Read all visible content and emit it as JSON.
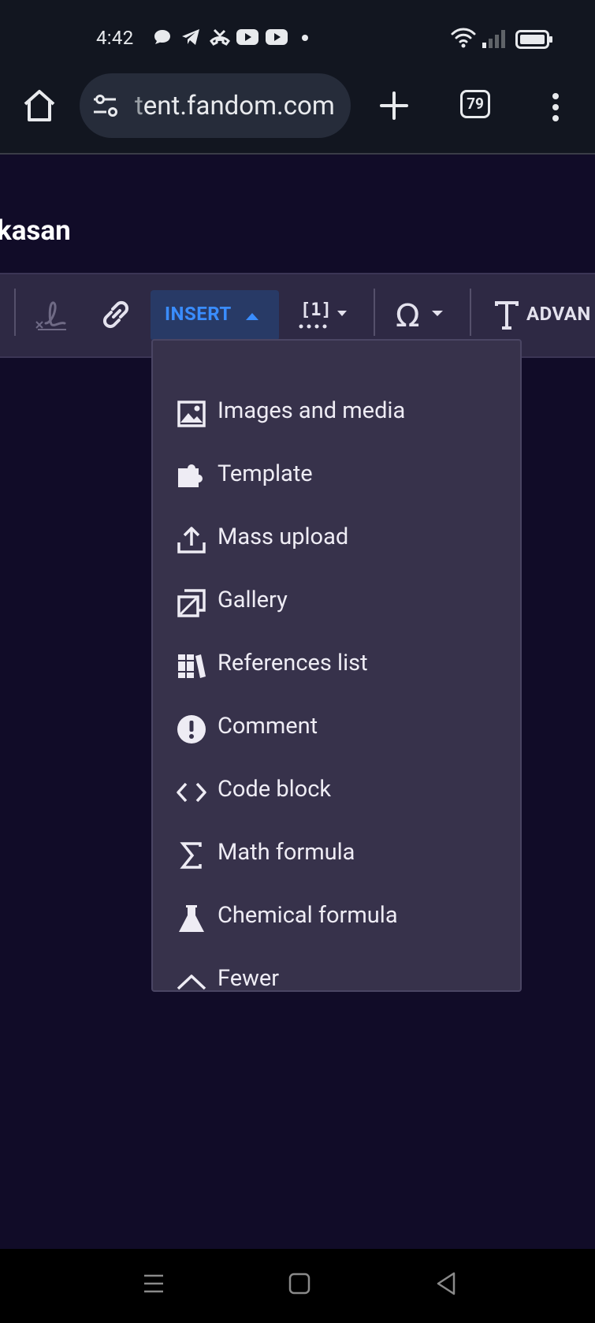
{
  "status_bar": {
    "time": "4:42"
  },
  "browser": {
    "url_faded": "t",
    "url": "ent.fandom.com",
    "tab_count": "79"
  },
  "page": {
    "title": "kasan"
  },
  "toolbar": {
    "insert_label": "INSERT",
    "advanced_label": "ADVAN"
  },
  "insert_menu": {
    "items": [
      {
        "label": "Images and media",
        "icon": "image-icon"
      },
      {
        "label": "Template",
        "icon": "puzzle-icon"
      },
      {
        "label": "Mass upload",
        "icon": "upload-icon"
      },
      {
        "label": "Gallery",
        "icon": "gallery-icon"
      },
      {
        "label": "References list",
        "icon": "books-icon"
      },
      {
        "label": "Comment",
        "icon": "exclamation-icon"
      },
      {
        "label": "Code block",
        "icon": "code-icon"
      },
      {
        "label": "Math formula",
        "icon": "sigma-icon"
      },
      {
        "label": "Chemical formula",
        "icon": "flask-icon"
      },
      {
        "label": "Fewer",
        "icon": "chevron-up-icon"
      }
    ]
  },
  "colors": {
    "page_bg": "#110c28",
    "toolbar_bg": "#2e2944",
    "menu_bg": "#37324b",
    "accent": "#3a8dff"
  }
}
